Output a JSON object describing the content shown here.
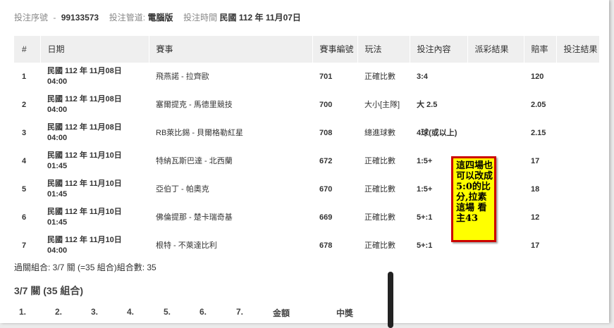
{
  "meta": {
    "serial_label": "投注序號",
    "serial_sep": "-",
    "serial_value": "99133573",
    "channel_label": "投注管道:",
    "channel_value": "電腦版",
    "time_label": "投注時間",
    "time_value": "民國 112 年 11月07日"
  },
  "table": {
    "headers": [
      "#",
      "日期",
      "賽事",
      "賽事編號",
      "玩法",
      "投注內容",
      "派彩結果",
      "賠率",
      "投注結果"
    ],
    "rows": [
      {
        "num": "1",
        "date_line1": "民國 112 年 11月08日",
        "date_line2": "04:00",
        "match": "飛燕諾 - 拉齊歐",
        "code": "701",
        "play": "正確比數",
        "content": "3:4",
        "payout": "",
        "odds": "120",
        "result": ""
      },
      {
        "num": "2",
        "date_line1": "民國 112 年 11月08日",
        "date_line2": "04:00",
        "match": "塞爾提克 - 馬德里競技",
        "code": "700",
        "play": "大小[主隊]",
        "content": "大 2.5",
        "payout": "",
        "odds": "2.05",
        "result": ""
      },
      {
        "num": "3",
        "date_line1": "民國 112 年 11月08日",
        "date_line2": "04:00",
        "match": "RB萊比錫 - 貝爾格勒紅星",
        "code": "708",
        "play": "總進球數",
        "content": "4球(或以上)",
        "payout": "",
        "odds": "2.15",
        "result": ""
      },
      {
        "num": "4",
        "date_line1": "民國 112 年 11月10日",
        "date_line2": "01:45",
        "match": "特納瓦斯巴達 - 北西蘭",
        "code": "672",
        "play": "正確比數",
        "content": "1:5+",
        "payout": "",
        "odds": "17",
        "result": ""
      },
      {
        "num": "5",
        "date_line1": "民國 112 年 11月10日",
        "date_line2": "01:45",
        "match": "亞伯丁 - 帕奧克",
        "code": "670",
        "play": "正確比數",
        "content": "1:5+",
        "payout": "",
        "odds": "18",
        "result": ""
      },
      {
        "num": "6",
        "date_line1": "民國 112 年 11月10日",
        "date_line2": "01:45",
        "match": "佛倫提那 - 楚卡瑞奇基",
        "code": "669",
        "play": "正確比數",
        "content": "5+:1",
        "payout": "",
        "odds": "12",
        "result": ""
      },
      {
        "num": "7",
        "date_line1": "民國 112 年 11月10日",
        "date_line2": "04:00",
        "match": "根特 - 不萊達比利",
        "code": "678",
        "play": "正確比數",
        "content": "5+:1",
        "payout": "",
        "odds": "17",
        "result": ""
      }
    ]
  },
  "summary": "過關組合: 3/7 關 (=35 組合)組合數: 35",
  "section_title": "3/7 關 (35 組合)",
  "combo_headers": [
    "1.",
    "2.",
    "3.",
    "4.",
    "5.",
    "6.",
    "7.",
    "金額",
    "中獎"
  ],
  "annotation": "這四場也可以改成5:0的比分,拉素這場 看主43"
}
